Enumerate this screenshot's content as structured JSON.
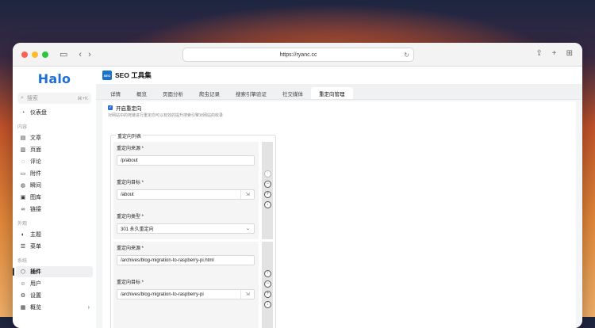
{
  "browser": {
    "url": "https://ryanc.cc"
  },
  "sidebar": {
    "logo": "Halo",
    "search_placeholder": "搜索",
    "search_shortcut": "⌘+K",
    "top_items": [
      {
        "label": "仪表盘",
        "icon": "dashboard-icon"
      }
    ],
    "groups": [
      {
        "title": "内容",
        "items": [
          {
            "label": "文章",
            "icon": "document-icon"
          },
          {
            "label": "页面",
            "icon": "page-icon"
          },
          {
            "label": "评论",
            "icon": "comment-icon"
          },
          {
            "label": "附件",
            "icon": "attachment-icon"
          },
          {
            "label": "瞬间",
            "icon": "moment-icon"
          },
          {
            "label": "图库",
            "icon": "gallery-icon"
          },
          {
            "label": "链接",
            "icon": "link-icon"
          }
        ]
      },
      {
        "title": "外观",
        "items": [
          {
            "label": "主题",
            "icon": "theme-icon"
          },
          {
            "label": "菜单",
            "icon": "menu-icon"
          }
        ]
      },
      {
        "title": "系统",
        "items": [
          {
            "label": "插件",
            "icon": "plugin-icon",
            "active": true
          },
          {
            "label": "用户",
            "icon": "user-icon"
          },
          {
            "label": "设置",
            "icon": "settings-icon"
          },
          {
            "label": "概览",
            "icon": "overview-icon",
            "has_chevron": true
          }
        ]
      }
    ]
  },
  "page": {
    "badge": "SEO",
    "title": "SEO 工具集",
    "tabs": [
      "详情",
      "概览",
      "页面分析",
      "爬虫记录",
      "搜索引擎验证",
      "社交媒体",
      "重定向管理"
    ],
    "active_tab": 6
  },
  "redirect": {
    "enable_label": "开启重定向",
    "enable_desc": "对网站中的死链进行重定向可以有效的提升搜索引擎对网站的收录",
    "list_title": "重定向列表",
    "source_label": "重定向来源 *",
    "target_label": "重定向目标 *",
    "type_label": "重定向类型 *",
    "rules": [
      {
        "source": "/p/about",
        "target": "/about",
        "type": "301 永久重定向"
      },
      {
        "source": "/archives/blog-migration-to-raspberry-pi.html",
        "target": "/archives/blog-migration-to-raspberry-pi"
      }
    ]
  }
}
